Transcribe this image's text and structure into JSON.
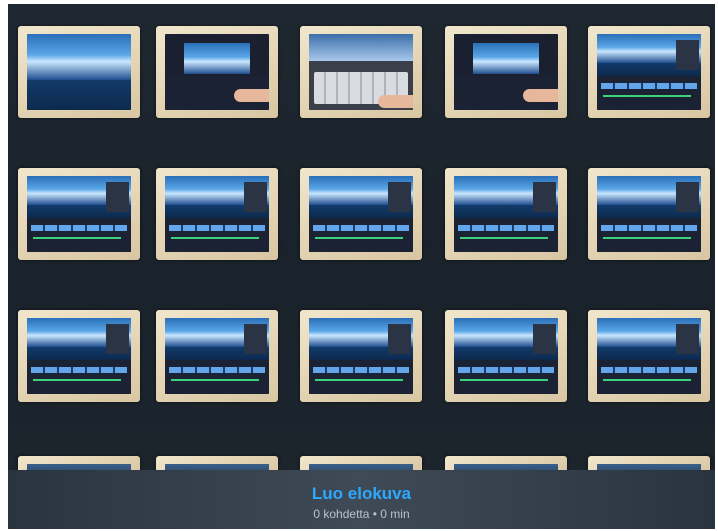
{
  "create_bar": {
    "title": "Luo elokuva",
    "subtitle": "0 kohdetta • 0 min"
  },
  "thumbnails": [
    {
      "row": 1,
      "col": 1,
      "content": "video-frame"
    },
    {
      "row": 1,
      "col": 2,
      "content": "editor-dialog"
    },
    {
      "row": 1,
      "col": 3,
      "content": "keyboard"
    },
    {
      "row": 1,
      "col": 4,
      "content": "editor-dialog"
    },
    {
      "row": 1,
      "col": 5,
      "content": "editor-timeline"
    },
    {
      "row": 2,
      "col": 1,
      "content": "editor-timeline"
    },
    {
      "row": 2,
      "col": 2,
      "content": "editor-timeline"
    },
    {
      "row": 2,
      "col": 3,
      "content": "editor-timeline"
    },
    {
      "row": 2,
      "col": 4,
      "content": "editor-timeline"
    },
    {
      "row": 2,
      "col": 5,
      "content": "editor-timeline"
    },
    {
      "row": 3,
      "col": 1,
      "content": "editor-timeline"
    },
    {
      "row": 3,
      "col": 2,
      "content": "editor-timeline"
    },
    {
      "row": 3,
      "col": 3,
      "content": "editor-timeline"
    },
    {
      "row": 3,
      "col": 4,
      "content": "editor-timeline"
    },
    {
      "row": 3,
      "col": 5,
      "content": "editor-timeline"
    },
    {
      "row": 4,
      "col": 1,
      "content": "partial"
    },
    {
      "row": 4,
      "col": 2,
      "content": "partial"
    },
    {
      "row": 4,
      "col": 3,
      "content": "partial"
    },
    {
      "row": 4,
      "col": 4,
      "content": "partial"
    },
    {
      "row": 4,
      "col": 5,
      "content": "partial"
    }
  ]
}
